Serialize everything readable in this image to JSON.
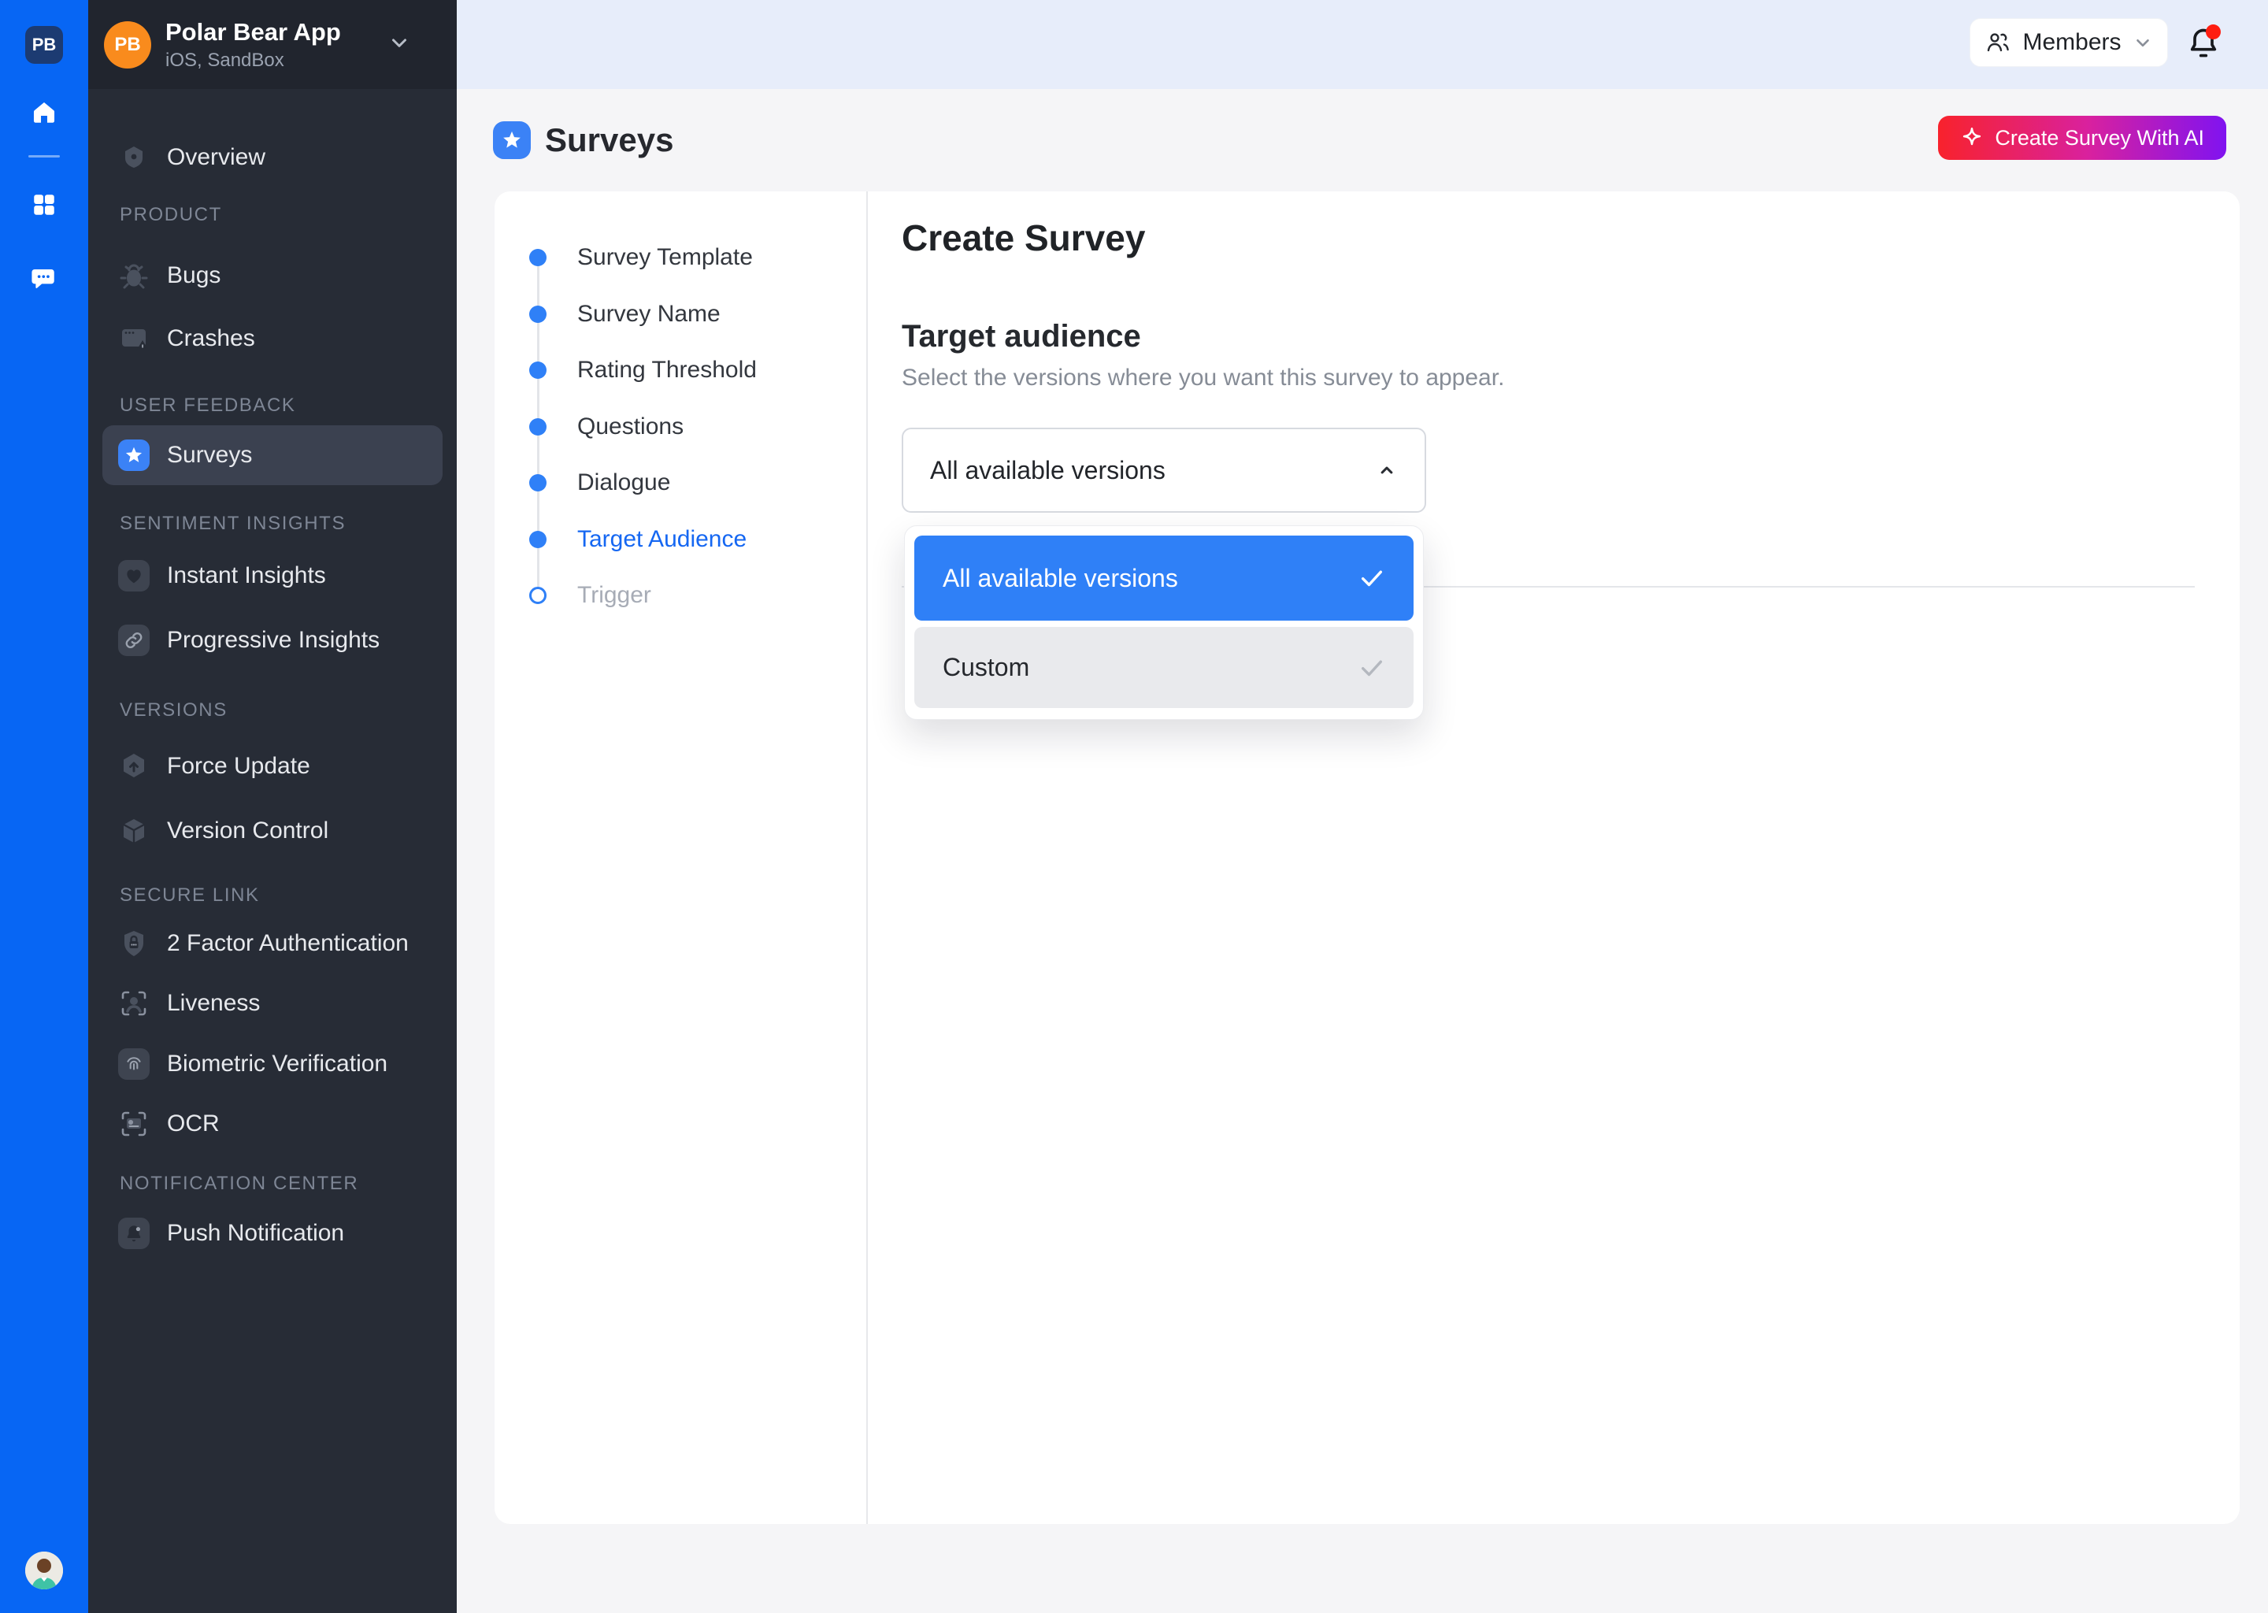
{
  "rail": {
    "initials": "PB",
    "icons": [
      "home-icon",
      "grid-icon",
      "chat-icon",
      "user-avatar"
    ]
  },
  "sidebar": {
    "app": {
      "initials": "PB",
      "name": "Polar Bear App",
      "env": "iOS, SandBox"
    },
    "sections": {
      "product": "PRODUCT",
      "user_feedback": "USER FEEDBACK",
      "sentiment": "SENTIMENT INSIGHTS",
      "versions": "VERSIONS",
      "secure_link": "SECURE LINK",
      "notification": "NOTIFICATION CENTER"
    },
    "items": {
      "overview": "Overview",
      "bugs": "Bugs",
      "crashes": "Crashes",
      "surveys": "Surveys",
      "instant": "Instant Insights",
      "progressive": "Progressive Insights",
      "force_update": "Force Update",
      "version_control": "Version Control",
      "tfa": "2 Factor Authentication",
      "liveness": "Liveness",
      "biometric": "Biometric Verification",
      "ocr": "OCR",
      "push": "Push Notification"
    },
    "active_item": "surveys"
  },
  "topbar": {
    "members_label": "Members",
    "bell_has_notification": true
  },
  "page": {
    "title": "Surveys",
    "ai_button_label": "Create Survey With AI"
  },
  "wizard": {
    "title": "Create Survey",
    "steps": [
      {
        "label": "Survey Template",
        "state": "done"
      },
      {
        "label": "Survey Name",
        "state": "done"
      },
      {
        "label": "Rating Threshold",
        "state": "done"
      },
      {
        "label": "Questions",
        "state": "done"
      },
      {
        "label": "Dialogue",
        "state": "done"
      },
      {
        "label": "Target Audience",
        "state": "active"
      },
      {
        "label": "Trigger",
        "state": "upcoming"
      }
    ]
  },
  "target_audience": {
    "heading": "Target audience",
    "description": "Select the versions where you want this survey to appear.",
    "select_value": "All available versions",
    "options": [
      {
        "label": "All available versions",
        "selected": true
      },
      {
        "label": "Custom",
        "selected": false
      }
    ]
  },
  "colors": {
    "rail_blue": "#0766F4",
    "accent_blue": "#2F80F7",
    "active_step_blue": "#1567F2",
    "star_icon_bg": "#3B82F6",
    "avatar_orange": "#F98B1D",
    "notification_red": "#FE1D10",
    "ai_gradient_start": "#F8222C",
    "ai_gradient_end": "#8013F0",
    "topbar_bg": "#E7EDFA",
    "sidebar_bg": "#272C36",
    "page_bg": "#F5F5F7"
  }
}
